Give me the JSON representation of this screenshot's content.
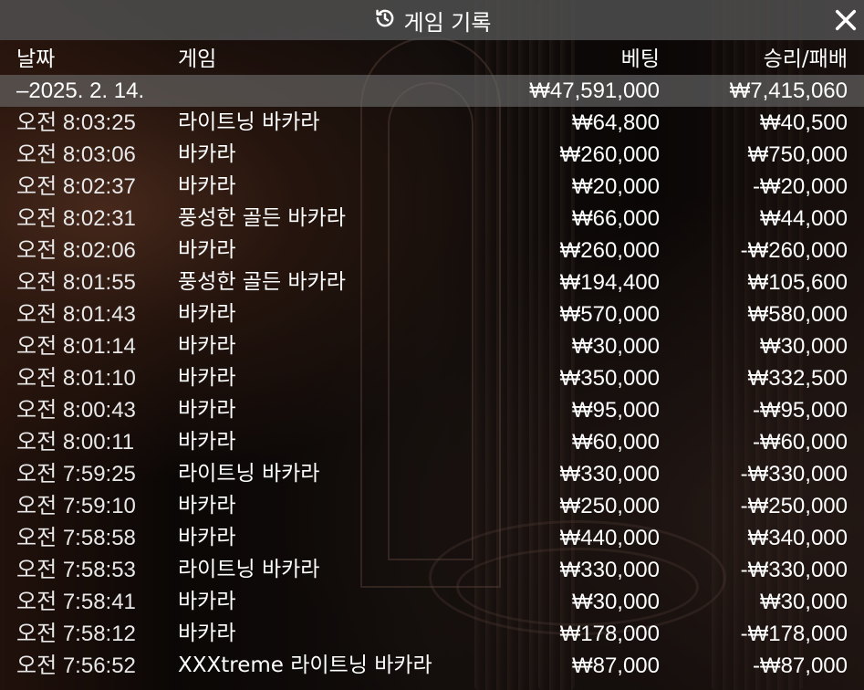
{
  "window": {
    "title": "게임 기록",
    "history_icon": "history-icon",
    "close_icon": "close-icon"
  },
  "header": {
    "date": "날짜",
    "game": "게임",
    "bet": "베팅",
    "result": "승리/패배"
  },
  "date_group": {
    "date": "–2025. 2. 14.",
    "bet_total": "₩47,591,000",
    "result_total": "₩7,415,060"
  },
  "rows": [
    {
      "time": "오전 8:03:25",
      "game": "라이트닝 바카라",
      "bet": "₩64,800",
      "result": "₩40,500"
    },
    {
      "time": "오전 8:03:06",
      "game": "바카라",
      "bet": "₩260,000",
      "result": "₩750,000"
    },
    {
      "time": "오전 8:02:37",
      "game": "바카라",
      "bet": "₩20,000",
      "result": "-₩20,000"
    },
    {
      "time": "오전 8:02:31",
      "game": "풍성한 골든 바카라",
      "bet": "₩66,000",
      "result": "₩44,000"
    },
    {
      "time": "오전 8:02:06",
      "game": "바카라",
      "bet": "₩260,000",
      "result": "-₩260,000"
    },
    {
      "time": "오전 8:01:55",
      "game": "풍성한 골든 바카라",
      "bet": "₩194,400",
      "result": "₩105,600"
    },
    {
      "time": "오전 8:01:43",
      "game": "바카라",
      "bet": "₩570,000",
      "result": "₩580,000"
    },
    {
      "time": "오전 8:01:14",
      "game": "바카라",
      "bet": "₩30,000",
      "result": "₩30,000"
    },
    {
      "time": "오전 8:01:10",
      "game": "바카라",
      "bet": "₩350,000",
      "result": "₩332,500"
    },
    {
      "time": "오전 8:00:43",
      "game": "바카라",
      "bet": "₩95,000",
      "result": "-₩95,000"
    },
    {
      "time": "오전 8:00:11",
      "game": "바카라",
      "bet": "₩60,000",
      "result": "-₩60,000"
    },
    {
      "time": "오전 7:59:25",
      "game": "라이트닝 바카라",
      "bet": "₩330,000",
      "result": "-₩330,000"
    },
    {
      "time": "오전 7:59:10",
      "game": "바카라",
      "bet": "₩250,000",
      "result": "-₩250,000"
    },
    {
      "time": "오전 7:58:58",
      "game": "바카라",
      "bet": "₩440,000",
      "result": "₩340,000"
    },
    {
      "time": "오전 7:58:53",
      "game": "라이트닝 바카라",
      "bet": "₩330,000",
      "result": "-₩330,000"
    },
    {
      "time": "오전 7:58:41",
      "game": "바카라",
      "bet": "₩30,000",
      "result": "₩30,000"
    },
    {
      "time": "오전 7:58:12",
      "game": "바카라",
      "bet": "₩178,000",
      "result": "-₩178,000"
    },
    {
      "time": "오전 7:56:52",
      "game": "XXXtreme 라이트닝 바카라",
      "bet": "₩87,000",
      "result": "-₩87,000"
    }
  ]
}
